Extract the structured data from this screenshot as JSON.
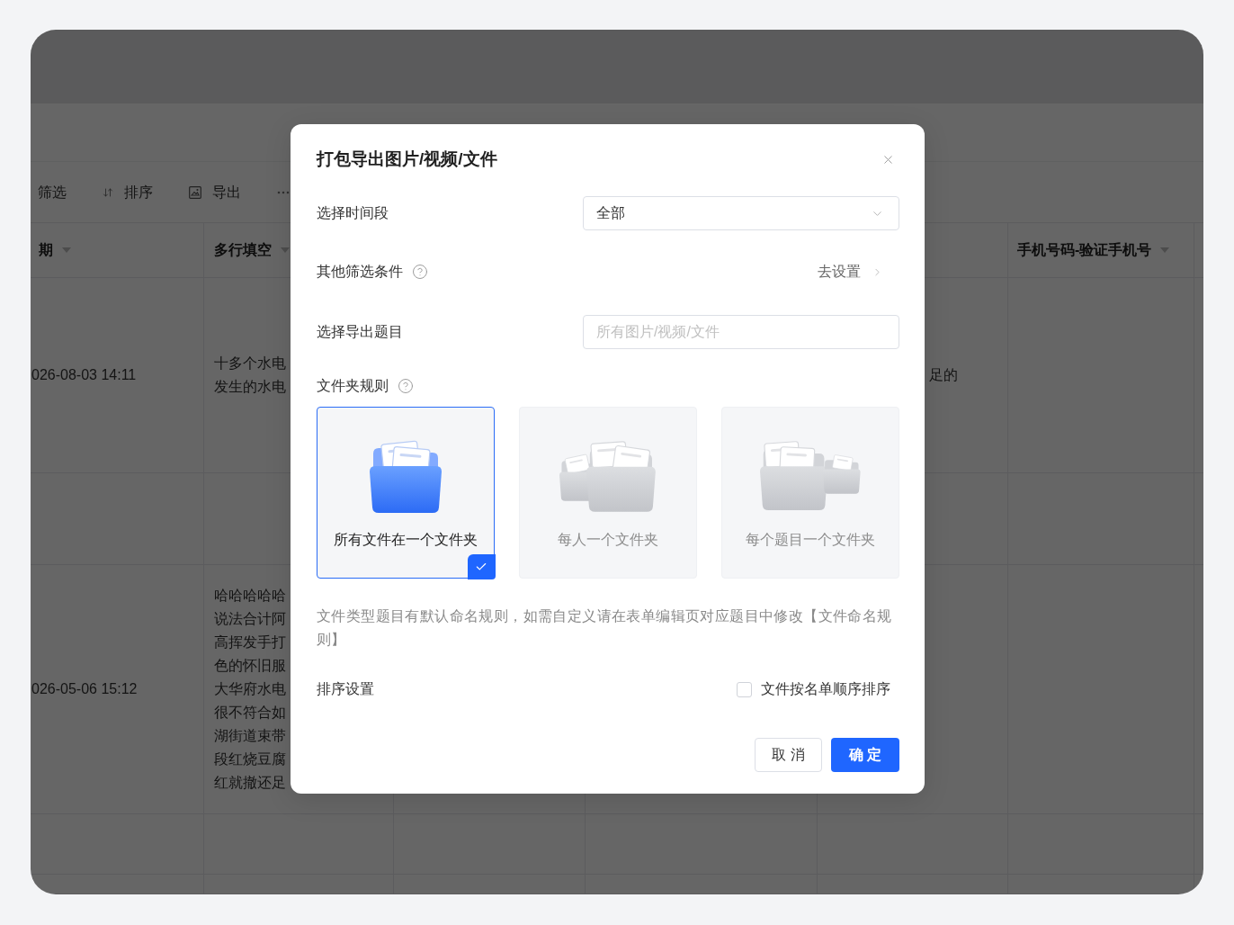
{
  "background": {
    "toolbar": [
      {
        "kind": "text",
        "label": "筛选"
      },
      {
        "kind": "sort",
        "label": "排序"
      },
      {
        "kind": "export",
        "label": "导出"
      },
      {
        "kind": "more"
      }
    ],
    "table": {
      "columns": [
        {
          "label": "期"
        },
        {
          "label": "多行填空"
        },
        null,
        null,
        null,
        {
          "label": "手机号码-验证手机号"
        }
      ],
      "rows": [
        {
          "cells": [
            [
              "026-08-03 14:11"
            ],
            [
              "十多个水电",
              "发生的水电"
            ],
            null,
            null,
            [
              "足的"
            ],
            null
          ]
        },
        {
          "cells": [
            null,
            null,
            null,
            null,
            null,
            null
          ]
        },
        {
          "cells": [
            [
              "026-05-06 15:12"
            ],
            [
              "哈哈哈哈哈",
              "说法合计阿",
              "高挥发手打",
              "色的怀旧服",
              "大华府水电",
              "很不符合如",
              "湖街道束带",
              "段红烧豆腐",
              "红就撤还足"
            ],
            null,
            null,
            null,
            null
          ]
        },
        {
          "cells": [
            null,
            null,
            null,
            null,
            null,
            null
          ]
        },
        {
          "cells": [
            null,
            null,
            null,
            null,
            null,
            null
          ]
        }
      ]
    }
  },
  "dialog": {
    "title": "打包导出图片/视频/文件",
    "fields": [
      {
        "kind": "select",
        "label": "选择时间段",
        "value": "全部"
      },
      {
        "kind": "link",
        "label": "其他筛选条件",
        "help": true,
        "link": "去设置"
      },
      {
        "kind": "input",
        "label": "选择导出题目",
        "placeholder": "所有图片/视频/文件"
      }
    ],
    "folder_rule": {
      "label": "文件夹规则",
      "help": true,
      "options": [
        {
          "kind": "single",
          "label": "所有文件在一个文件夹",
          "selected": true
        },
        {
          "kind": "per_person",
          "label": "每人一个文件夹",
          "selected": false
        },
        {
          "kind": "per_question",
          "label": "每个题目一个文件夹",
          "selected": false
        }
      ]
    },
    "note": "文件类型题目有默认命名规则，如需自定义请在表单编辑页对应题目中修改【文件命名规则】",
    "sort": {
      "label": "排序设置",
      "option": "文件按名单顺序排序",
      "checked": false
    },
    "buttons": [
      {
        "kind": "default",
        "label": "取 消"
      },
      {
        "kind": "primary",
        "label": "确 定"
      }
    ]
  }
}
